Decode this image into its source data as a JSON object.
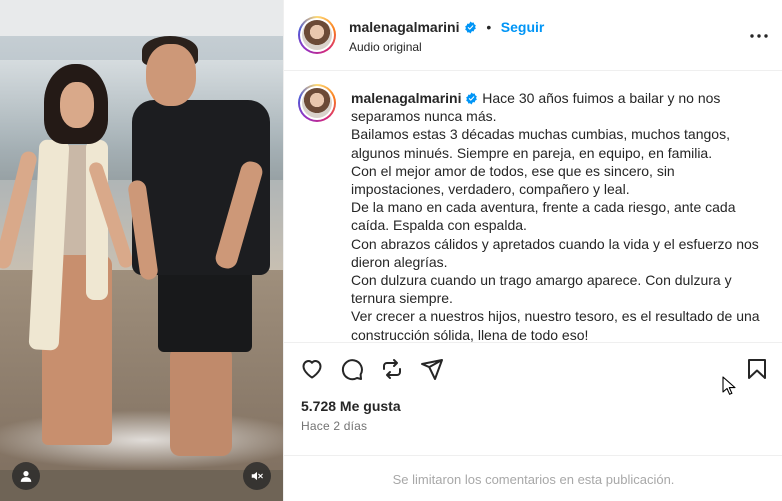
{
  "post": {
    "username": "malenagalmarini",
    "separator": "•",
    "follow_label": "Seguir",
    "audio_label": "Audio original",
    "caption_lines": [
      "Hace 30 años fuimos a bailar y no nos",
      "separamos nunca más.",
      "Bailamos estas 3 décadas muchas cumbias, muchos tangos,",
      "algunos minués. Siempre en pareja, en equipo, en familia.",
      "Con el mejor amor de todos, ese que es sincero, sin",
      "impostaciones, verdadero, compañero y leal.",
      "De la mano en cada aventura, frente a cada riesgo, ante cada",
      "caída. Espalda con espalda.",
      "Con abrazos cálidos y apretados cuando la vida y el esfuerzo nos",
      "dieron alegrías.",
      "Con dulzura cuando un trago amargo aparece. Con dulzura y",
      "ternura siempre.",
      "Ver crecer a nuestros hijos, nuestro tesoro, es el resultado de una",
      "construcción sólida, llena de todo eso!"
    ],
    "likes": "5.728 Me gusta",
    "time_ago": "Hace 2 días",
    "comments_notice": "Se limitaron los comentarios en esta publicación."
  },
  "icons": {
    "more": "more-options-icon",
    "verified": "verified-badge-icon",
    "like": "heart-icon",
    "comment": "comment-icon",
    "share": "repost-icon",
    "send": "send-icon",
    "save": "bookmark-icon",
    "user_tags": "user-tag-icon",
    "mute": "speaker-muted-icon"
  },
  "colors": {
    "accent": "#0095f6",
    "text": "#262626",
    "muted": "#737373",
    "divider": "#efefef"
  }
}
